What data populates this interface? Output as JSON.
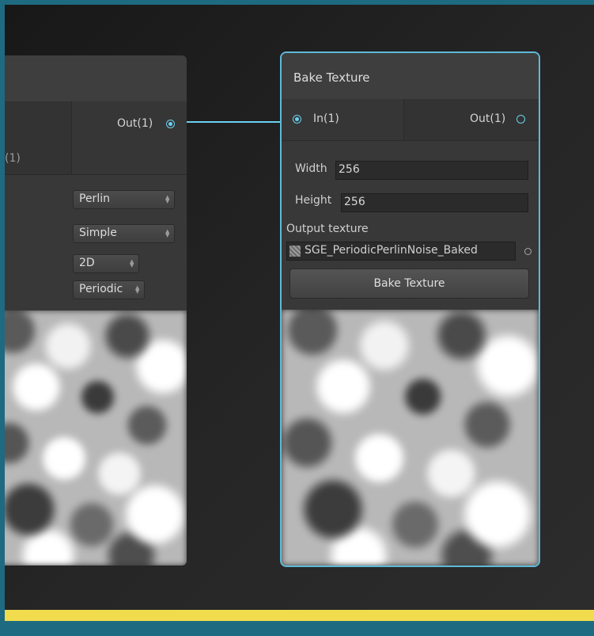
{
  "left_node": {
    "out_port_label": "Out(1)",
    "in_port_label_partial": "(1)",
    "dropdowns": [
      {
        "value": "Perlin"
      },
      {
        "value": "Simple"
      },
      {
        "value": "2D"
      },
      {
        "value": "Periodic"
      }
    ]
  },
  "right_node": {
    "title": "Bake Texture",
    "in_port_label": "In(1)",
    "out_port_label": "Out(1)",
    "width_label": "Width",
    "width_value": "256",
    "height_label": "Height",
    "height_value": "256",
    "output_texture_label": "Output texture",
    "output_texture_value": "SGE_PeriodicPerlinNoise_Baked",
    "bake_button_label": "Bake Texture"
  },
  "colors": {
    "selection_outline": "#5fb9d8",
    "connection": "#6bd0ee",
    "status_bar": "#f1dc4e",
    "frame": "#1e6a80"
  }
}
